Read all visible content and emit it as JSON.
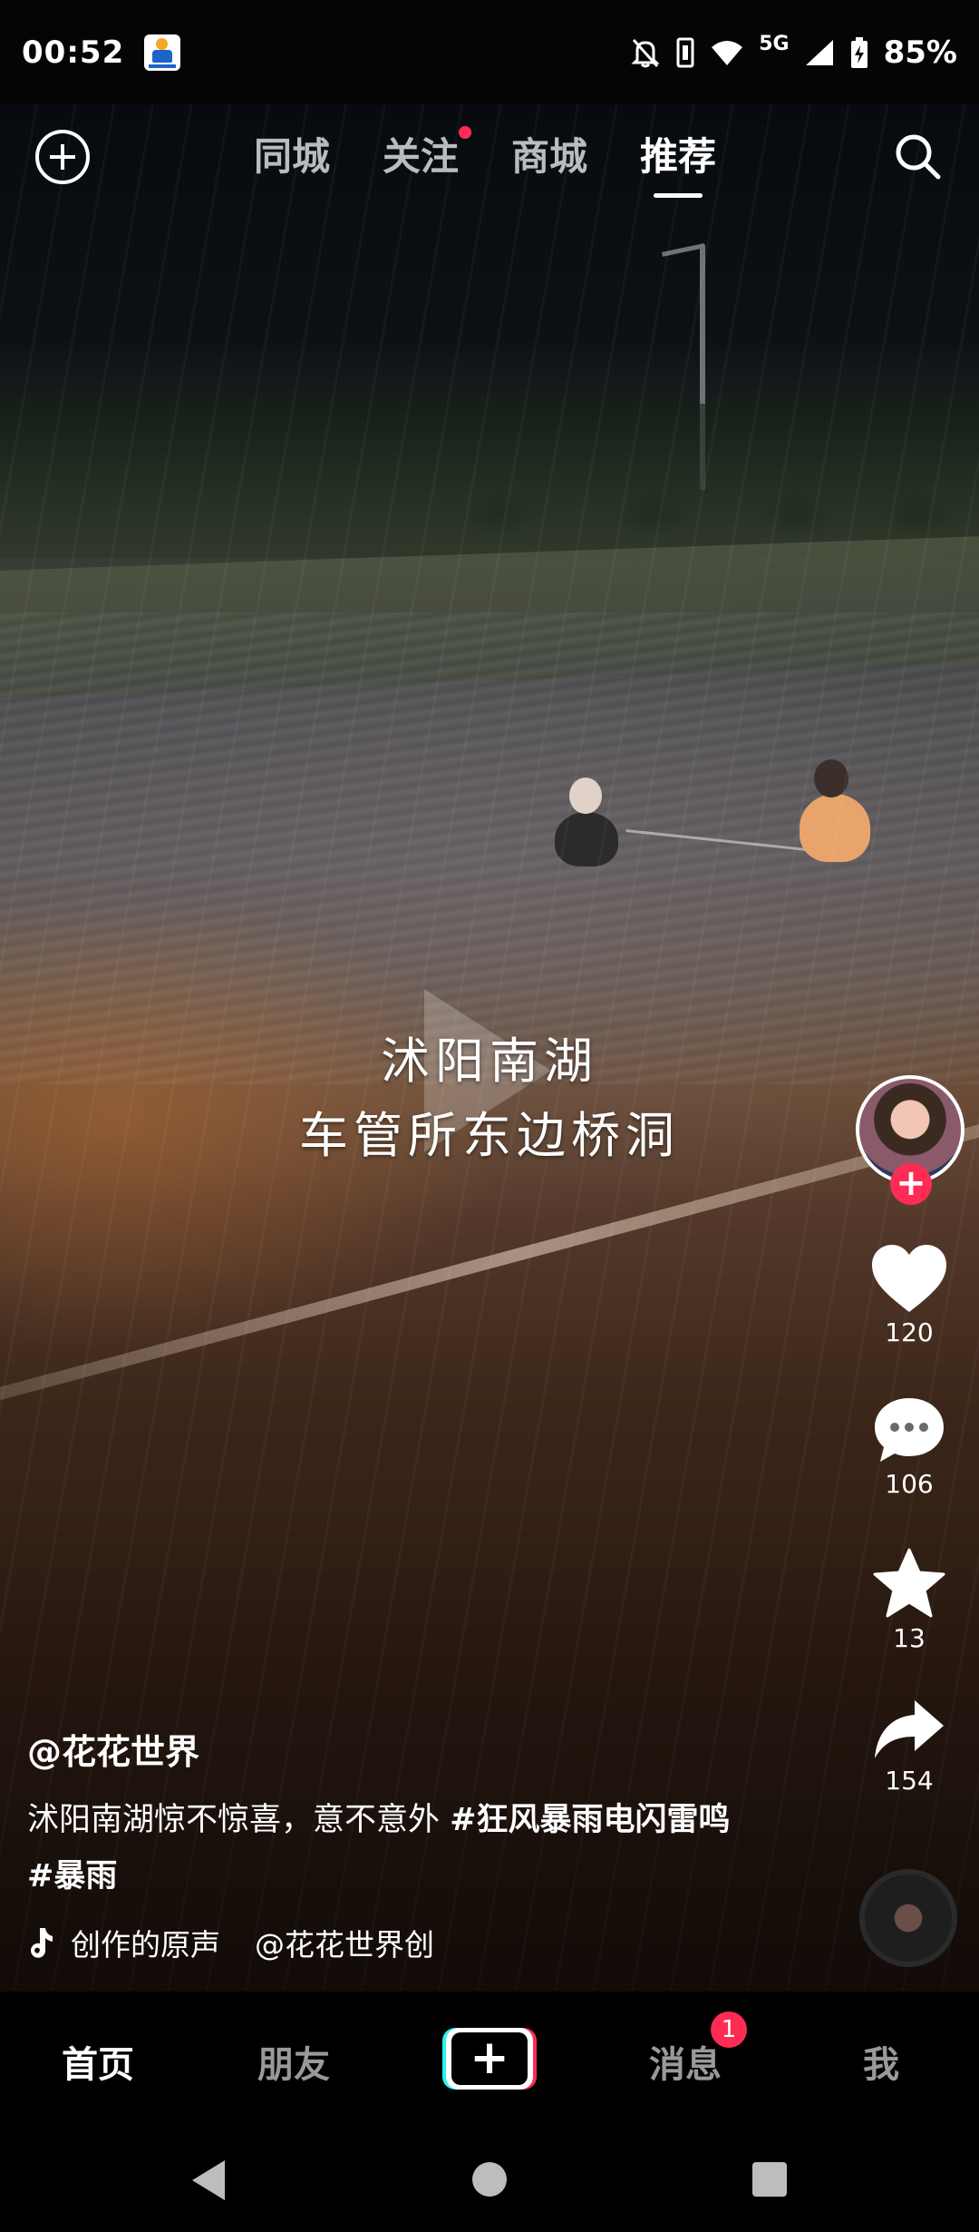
{
  "status_bar": {
    "time": "00:52",
    "network": "5G",
    "battery": "85%"
  },
  "top_nav": {
    "tabs": [
      {
        "label": "同城"
      },
      {
        "label": "关注"
      },
      {
        "label": "商城"
      },
      {
        "label": "推荐"
      }
    ],
    "active_tab": "推荐"
  },
  "video": {
    "caption_line1": "沭阳南湖",
    "caption_line2": "车管所东边桥洞"
  },
  "rail": {
    "likes": "120",
    "comments": "106",
    "favorites": "13",
    "shares": "154",
    "follow_symbol": "+"
  },
  "info": {
    "author": "@花花世界",
    "description": "沭阳南湖惊不惊喜，意不意外 ",
    "hashtag1": "#狂风暴雨电闪雷鸣",
    "hashtag2": "#暴雨",
    "music_title": "创作的原声",
    "music_author": "@花花世界创"
  },
  "tab_bar": {
    "home": "首页",
    "friends": "朋友",
    "create": "+",
    "messages": "消息",
    "messages_badge": "1",
    "me": "我"
  },
  "colors": {
    "accent": "#fe2c55",
    "cyan": "#25f4ee"
  }
}
